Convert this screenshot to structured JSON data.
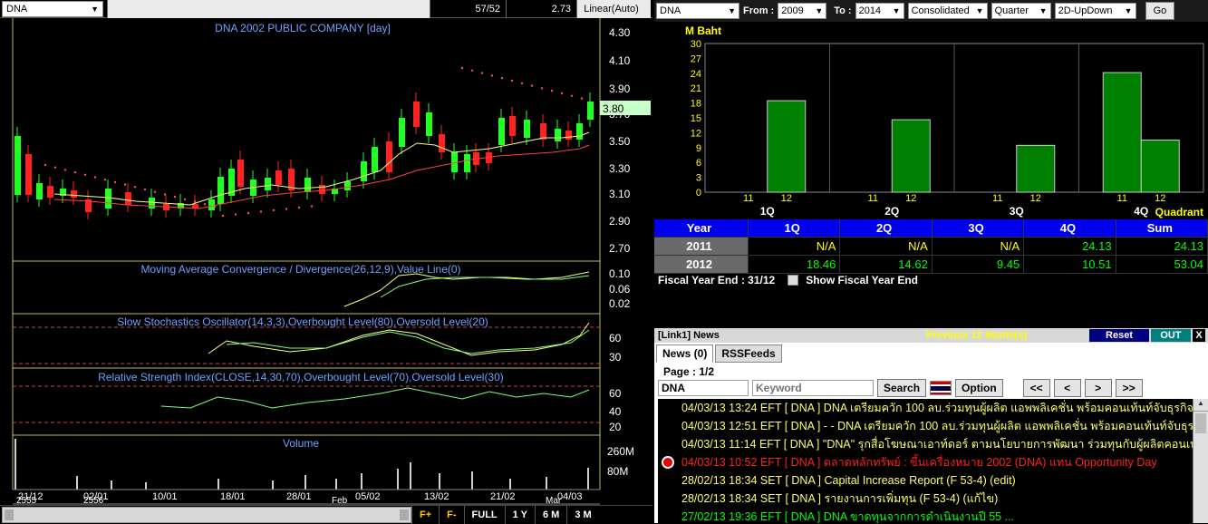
{
  "left": {
    "symbol": "DNA",
    "ratio": "57/52",
    "last": "2.73",
    "scale": "Linear(Auto)",
    "chart_title": "DNA 2002 PUBLIC COMPANY [day]",
    "price_axis": [
      "4.30",
      "4.10",
      "3.90",
      "3.70",
      "3.50",
      "3.30",
      "3.10",
      "2.90",
      "2.70"
    ],
    "price_tag": "3.80",
    "macd_label": "Moving Average Convergence / Divergence(26,12,9),Value Line(0)",
    "macd_axis": [
      "0.10",
      "0.06",
      "0.02"
    ],
    "sto_label": "Slow Stochastics Oscillator(14,3,3),Overbought Level(80),Oversold Level(20)",
    "sto_axis": [
      "60",
      "30"
    ],
    "rsi_label": "Relative Strength Index(CLOSE,14,30,70),Overbought Level(70),Oversold Level(30)",
    "rsi_axis": [
      "60",
      "40",
      "20"
    ],
    "volume_label": "Volume",
    "volume_axis": [
      "260M",
      "80M"
    ],
    "dates": [
      "21/12",
      "02/01",
      "10/01",
      "18/01",
      "28/01",
      "05/02",
      "13/02",
      "21/02",
      "04/03"
    ],
    "years": [
      "2555",
      "2556",
      "Feb",
      "Mar"
    ],
    "nav": [
      "F+",
      "F-",
      "FULL",
      "1 Y",
      "6 M",
      "3 M"
    ]
  },
  "right": {
    "symbol": "DNA",
    "from_label": "From :",
    "from_year": "2009",
    "to_label": "To :",
    "to_year": "2014",
    "mode": "Consolidated",
    "period": "Quarter",
    "chart_type": "2D-UpDown",
    "go": "Go",
    "unit": "M Baht",
    "quadrant": "Quadrant",
    "fiscal_label": "Fiscal  Year  End  :  31/12",
    "show_fiscal": "Show Fiscal Year End",
    "colors": {
      "bar": "#008000",
      "header": "#0000ee",
      "unit": "#ffff00",
      "value": "#00ff00",
      "warn": "#ffff00"
    }
  },
  "chart_data": {
    "type": "bar",
    "categories": [
      "1Q",
      "2Q",
      "3Q",
      "4Q"
    ],
    "sub_labels": [
      "11",
      "12"
    ],
    "ylim": [
      0,
      30
    ],
    "yticks": [
      "30",
      "27",
      "24",
      "21",
      "18",
      "15",
      "12",
      "9",
      "6",
      "3",
      "0"
    ],
    "series": [
      {
        "name": "11",
        "values": [
          null,
          null,
          null,
          24.13
        ]
      },
      {
        "name": "12",
        "values": [
          18.46,
          14.62,
          9.45,
          10.51
        ]
      }
    ]
  },
  "table": {
    "headers": [
      "Year",
      "1Q",
      "2Q",
      "3Q",
      "4Q",
      "Sum"
    ],
    "rows": [
      {
        "year": "2011",
        "cells": [
          "N/A",
          "N/A",
          "N/A",
          "24.13",
          "24.13"
        ]
      },
      {
        "year": "2012",
        "cells": [
          "18.46",
          "14.62",
          "9.45",
          "10.51",
          "53.04"
        ]
      }
    ]
  },
  "news": {
    "bar_title": "[Link1] News",
    "previous": "Previous 12 Month(s)",
    "reset": "Reset",
    "out": "OUT",
    "close": "X",
    "tabs": [
      "News (0)",
      "RSSFeeds"
    ],
    "page": "Page : 1/2",
    "symbol_value": "DNA",
    "keyword_placeholder": "Keyword",
    "search": "Search",
    "option": "Option",
    "pager": [
      "<<",
      "<",
      ">",
      ">>"
    ],
    "items": [
      {
        "date": "04/03/13 13:24",
        "src": "EFT",
        "sym": "[ DNA ]",
        "text": "DNA เตรียมควัก 100 ลบ.ร่วมทุนผู้ผลิต แอพพลิเคชั่น พร้อมคอนเท้นท์จับธุรกิจ...",
        "color": "#ffff66",
        "icon": false
      },
      {
        "date": "04/03/13 12:51",
        "src": "EFT",
        "sym": "[ DNA ]",
        "text": "- - DNA เตรียมควัก 100 ลบ.ร่วมทุนผู้ผลิต แอพพลิเคชั่น พร้อมคอนเท้นท์จับธุร...",
        "color": "#ffff66",
        "icon": false
      },
      {
        "date": "04/03/13 11:14",
        "src": "EFT",
        "sym": "[ DNA ]",
        "text": "\"DNA\" รุกสื่อโฆษณาเอาท์ดอร์ ตามนโยบายการพัฒนา ร่วมทุนกับผู้ผลิตคอนเทนต์...",
        "color": "#ffff66",
        "icon": false
      },
      {
        "date": "04/03/13 10:52",
        "src": "EFT",
        "sym": "[ DNA ]",
        "text": "ตลาดหลักทรัพย์ : ขึ้นเครื่องหมาย 2002 (DNA) แทน Opportunity Day",
        "color": "#ff2020",
        "icon": true
      },
      {
        "date": "28/02/13 18:34",
        "src": "SET",
        "sym": "[ DNA ]",
        "text": "Capital Increase Report (F 53-4) (edit)",
        "color": "#ffff66",
        "icon": false
      },
      {
        "date": "28/02/13 18:34",
        "src": "SET",
        "sym": "[ DNA ]",
        "text": "รายงานการเพิ่มทุน (F 53-4) (แก้ไข)",
        "color": "#ffff66",
        "icon": false
      },
      {
        "date": "27/02/13 19:36",
        "src": "EFT",
        "sym": "[ DNA ]",
        "text": "DNA ขาดทุนจากการดำเนินงานปี 55 ...",
        "color": "#00ff00",
        "icon": false
      }
    ]
  }
}
